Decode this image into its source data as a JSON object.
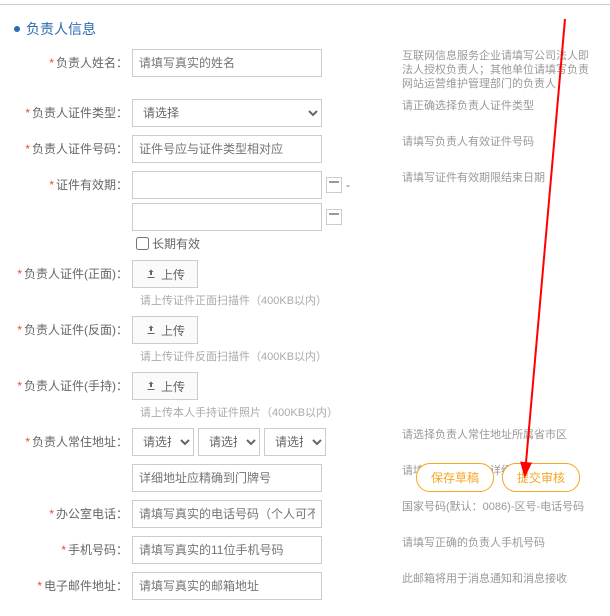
{
  "section_title": "负责人信息",
  "labels": {
    "name": "负责人姓名：",
    "id_type": "负责人证件类型：",
    "id_number": "负责人证件号码：",
    "id_expiry": "证件有效期：",
    "id_front": "负责人证件(正面)：",
    "id_back": "负责人证件(反面)：",
    "id_hand": "负责人证件(手持)：",
    "address": "负责人常住地址：",
    "office_tel": "办公室电话：",
    "mobile": "手机号码：",
    "email": "电子邮件地址："
  },
  "placeholders": {
    "name": "请填写真实的姓名",
    "id_number": "证件号应与证件类型相对应",
    "detail_addr": "详细地址应精确到门牌号",
    "office_tel": "请填写真实的电话号码（个人可不填）",
    "mobile": "请填写真实的11位手机号码",
    "email": "请填写真实的邮箱地址"
  },
  "options": {
    "please_select": "请选择"
  },
  "upload": "上传",
  "checkbox_long": "长期有效",
  "hints": {
    "name": "互联网信息服务企业请填写公司法人即法人授权负责人；其他单位请填写负责网站运营维护管理部门的负责人",
    "id_type": "请正确选择负责人证件类型",
    "id_number": "请填写负责人有效证件号码",
    "id_expiry": "请填写证件有效期限结束日期",
    "id_front": "请上传证件正面扫描件（400KB以内）",
    "id_back": "请上传证件反面扫描件（400KB以内）",
    "id_hand": "请上传本人手持证件照片（400KB以内）",
    "address": "请选择负责人常住地址所属省市区",
    "detail_addr": "请填写负责人常住详细地址",
    "office_tel": "国家号码(默认：0086)-区号-电话号码",
    "mobile": "请填写正确的负责人手机号码",
    "email": "此邮箱将用于消息通知和消息接收"
  },
  "buttons": {
    "save_draft": "保存草稿",
    "submit": "提交审核"
  }
}
